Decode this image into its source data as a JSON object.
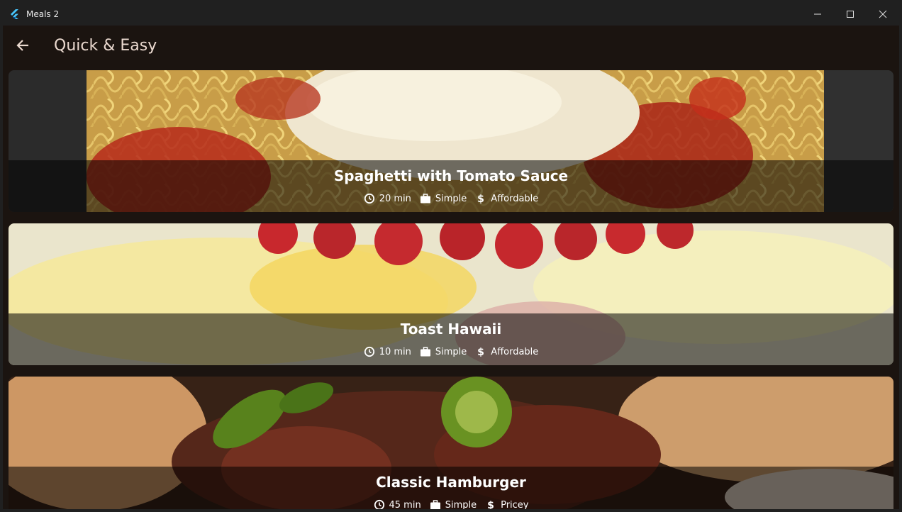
{
  "window": {
    "title": "Meals 2"
  },
  "appbar": {
    "title": "Quick & Easy"
  },
  "meals": [
    {
      "title": "Spaghetti with Tomato Sauce",
      "duration": "20 min",
      "complexity": "Simple",
      "affordability": "Affordable"
    },
    {
      "title": "Toast Hawaii",
      "duration": "10 min",
      "complexity": "Simple",
      "affordability": "Affordable"
    },
    {
      "title": "Classic Hamburger",
      "duration": "45 min",
      "complexity": "Simple",
      "affordability": "Pricey"
    }
  ],
  "icons": {
    "back": "arrow-left-icon",
    "duration": "clock-icon",
    "complexity": "briefcase-icon",
    "affordability": "dollar-icon"
  },
  "colors": {
    "background": "#1b1410",
    "titlebar": "#202020",
    "appbar_text": "#ead9cf",
    "overlay": "rgba(0,0,0,0.54)"
  }
}
